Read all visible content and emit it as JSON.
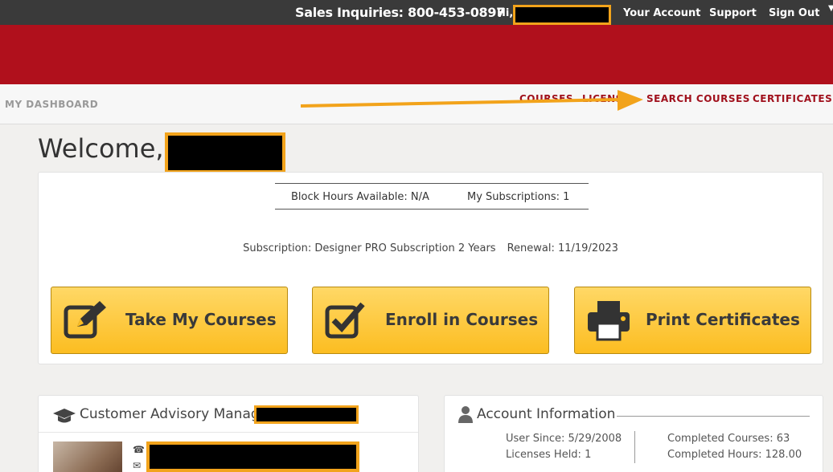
{
  "topbar": {
    "sales": "Sales Inquiries: 800-453-0897",
    "hi": "Hi,",
    "links": [
      "Your Account",
      "Support",
      "Sign Out"
    ]
  },
  "navbar": {
    "dashboard": "MY DASHBOARD",
    "items": [
      "COURSES",
      "LICENS",
      "SEARCH COURSES",
      "CERTIFICATES"
    ]
  },
  "welcome": "Welcome,",
  "stats": {
    "block_hours": "Block Hours Available: N/A",
    "subscriptions": "My Subscriptions: 1"
  },
  "subscription": {
    "name": "Subscription: Designer PRO Subscription 2 Years",
    "renewal": "Renewal: 11/19/2023"
  },
  "buttons": {
    "take": "Take My Courses",
    "enroll": "Enroll in Courses",
    "print": "Print Certificates"
  },
  "advisory": {
    "title": "Customer Advisory Manager:"
  },
  "account": {
    "title": "Account Information",
    "user_since": "User Since: 5/29/2008",
    "licenses": "Licenses Held: 1",
    "courses": "Completed Courses: 63",
    "hours": "Completed Hours: 128.00"
  },
  "colors": {
    "brand_red": "#b0101c",
    "nav_red": "#a0101c",
    "button_gold": "#fcbd21",
    "highlight": "#f2a31b"
  }
}
